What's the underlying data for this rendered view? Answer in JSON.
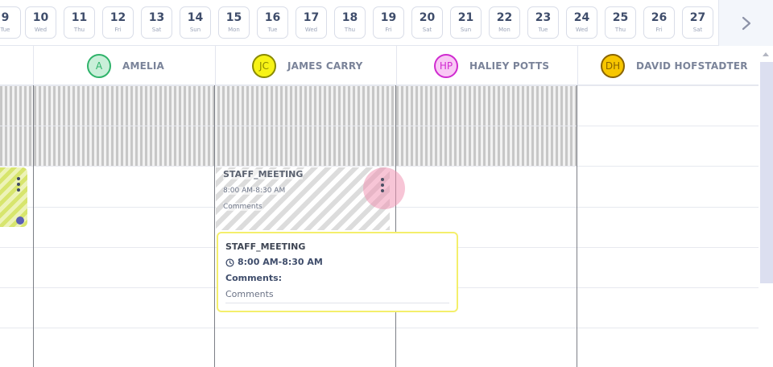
{
  "dates": [
    {
      "num": "9",
      "dow": "Tue"
    },
    {
      "num": "10",
      "dow": "Wed"
    },
    {
      "num": "11",
      "dow": "Thu"
    },
    {
      "num": "12",
      "dow": "Fri"
    },
    {
      "num": "13",
      "dow": "Sat"
    },
    {
      "num": "14",
      "dow": "Sun"
    },
    {
      "num": "15",
      "dow": "Mon"
    },
    {
      "num": "16",
      "dow": "Tue"
    },
    {
      "num": "17",
      "dow": "Wed"
    },
    {
      "num": "18",
      "dow": "Thu"
    },
    {
      "num": "19",
      "dow": "Fri"
    },
    {
      "num": "20",
      "dow": "Sat"
    },
    {
      "num": "21",
      "dow": "Sun"
    },
    {
      "num": "22",
      "dow": "Mon"
    },
    {
      "num": "23",
      "dow": "Tue"
    },
    {
      "num": "24",
      "dow": "Wed"
    },
    {
      "num": "25",
      "dow": "Thu"
    },
    {
      "num": "26",
      "dow": "Fri"
    },
    {
      "num": "27",
      "dow": "Sat"
    }
  ],
  "staff": [
    {
      "initials": "A",
      "name": "AMELIA",
      "color": "#2fb36a",
      "bg": "#c9efd9",
      "text": "#2fb36a"
    },
    {
      "initials": "JC",
      "name": "JAMES CARRY",
      "color": "#8a8a00",
      "bg": "#f7f316",
      "text": "#8a8a00"
    },
    {
      "initials": "HP",
      "name": "HALIEY POTTS",
      "color": "#d02bd0",
      "bg": "#f9c8f5",
      "text": "#d02bd0"
    },
    {
      "initials": "DH",
      "name": "DAVID HOFSTADTER",
      "color": "#8a6400",
      "bg": "#f7c600",
      "text": "#8a6400"
    }
  ],
  "event": {
    "title": "STAFF_MEETING",
    "time": "8:00 AM-8:30 AM",
    "comments": "Comments"
  },
  "tooltip": {
    "title": "STAFF_MEETING",
    "time": "8:00 AM-8:30 AM",
    "comments_label": "Comments:",
    "comments_value": "Comments"
  }
}
